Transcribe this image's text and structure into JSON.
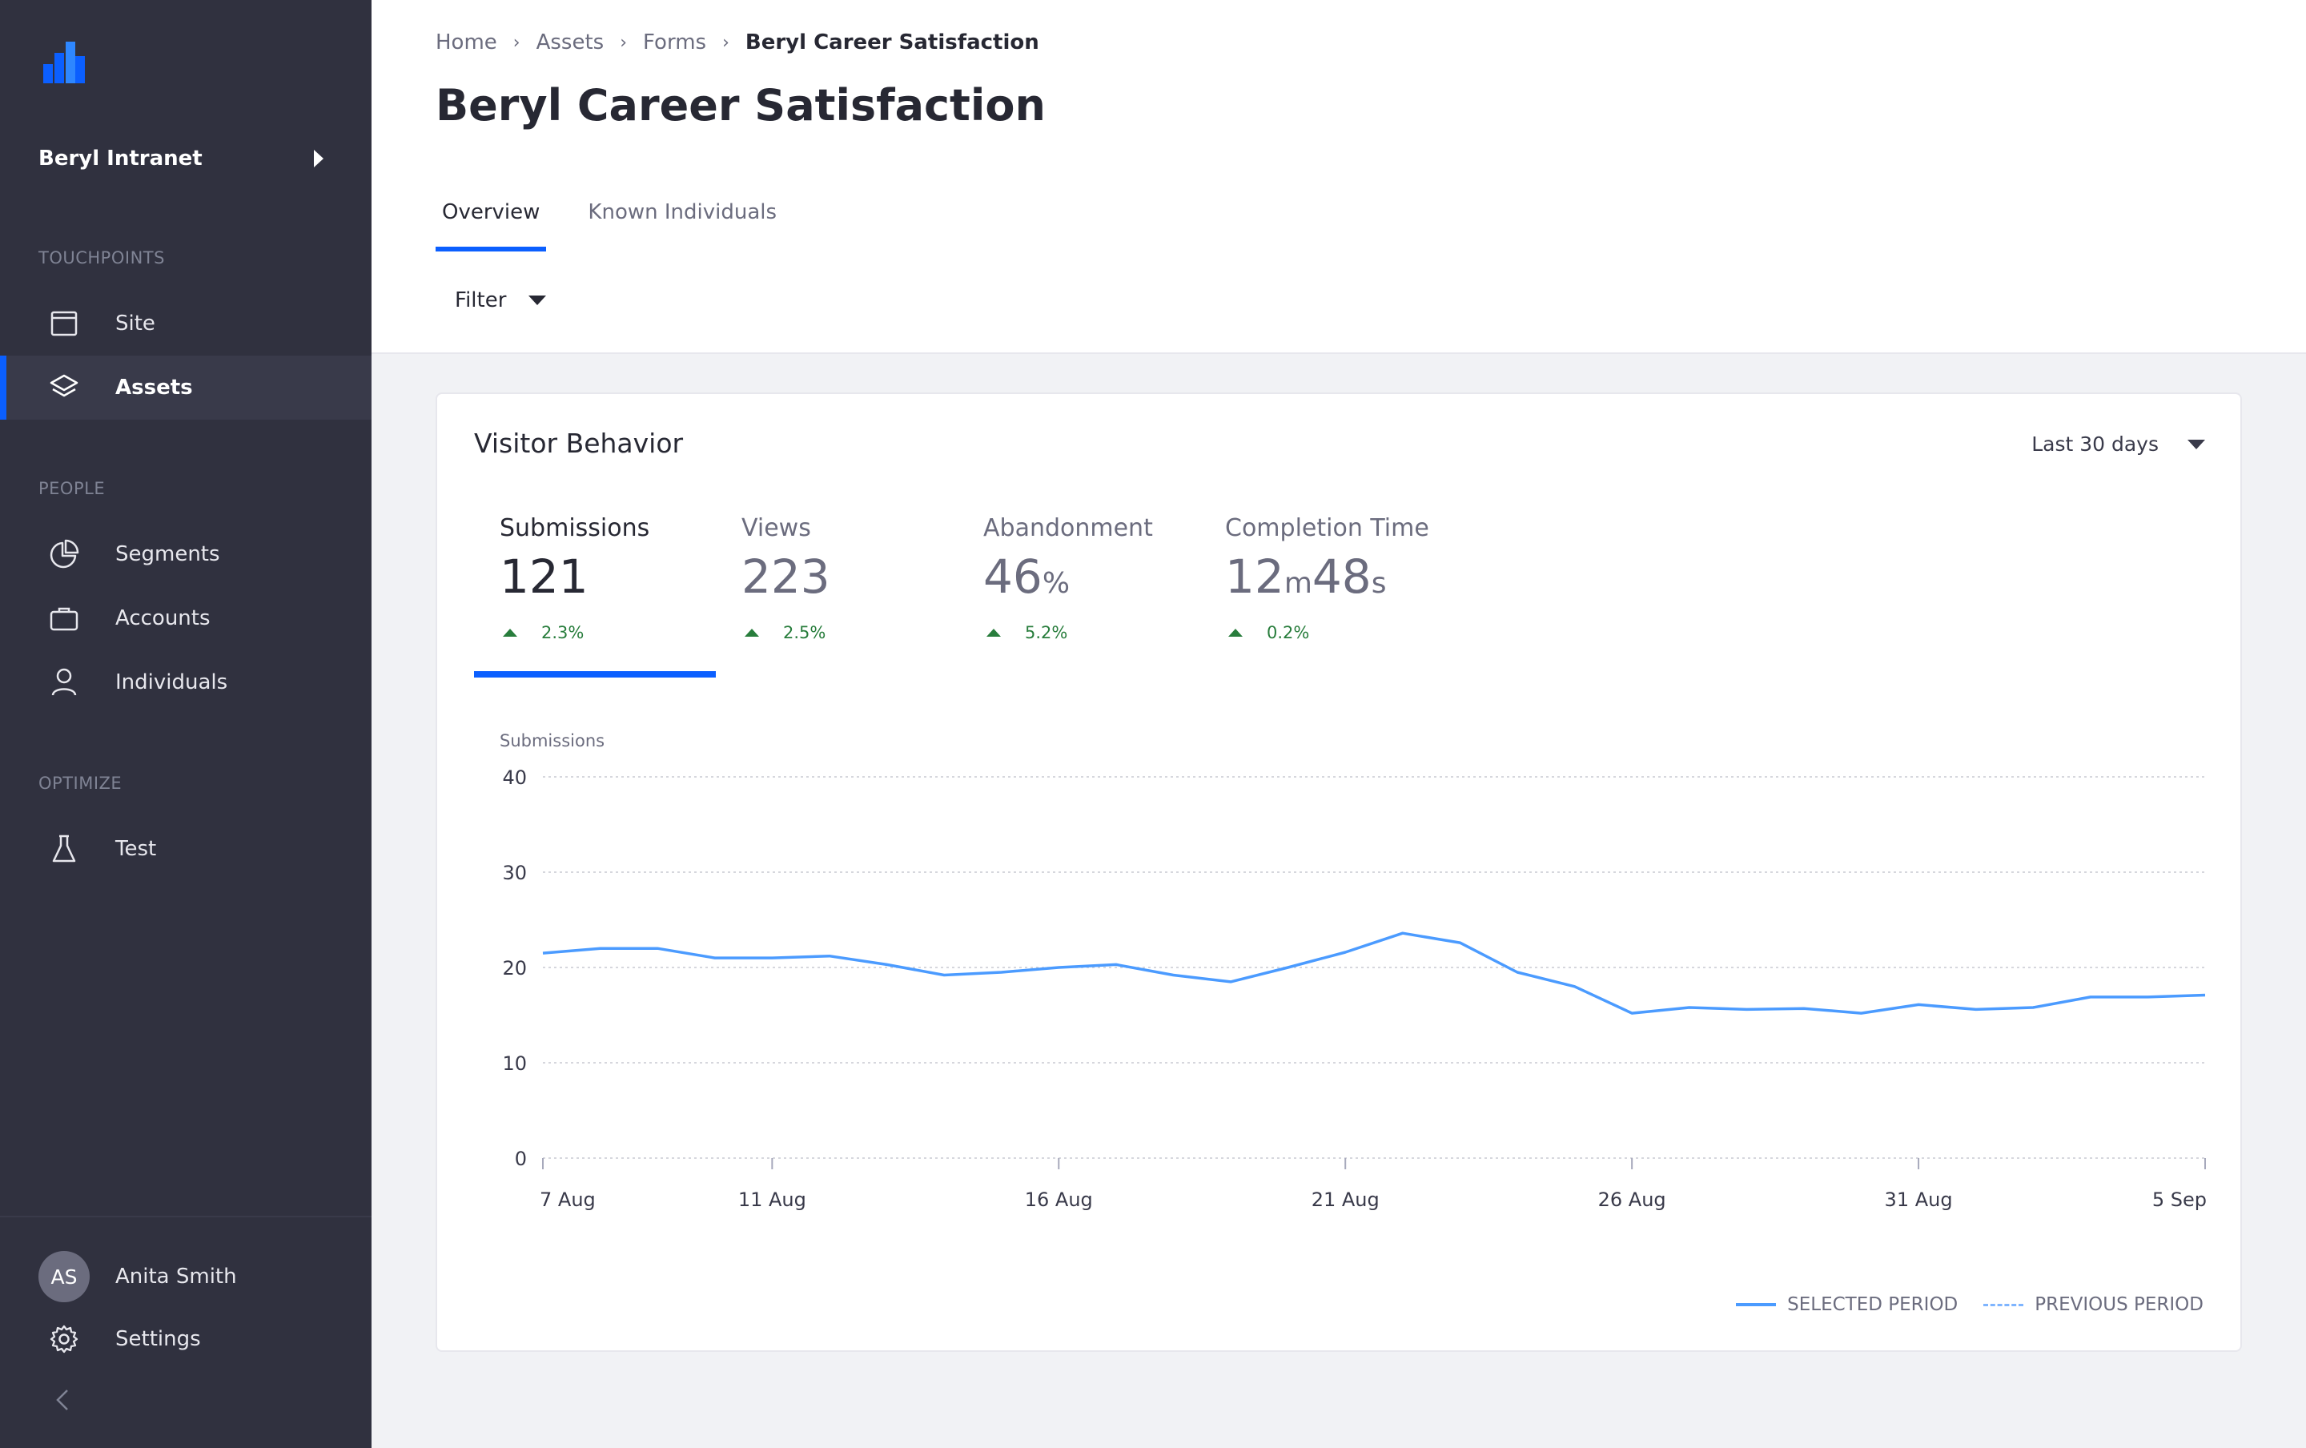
{
  "sidebar": {
    "property_name": "Beryl Intranet",
    "sections": {
      "touchpoints": "TOUCHPOINTS",
      "people": "PEOPLE",
      "optimize": "OPTIMIZE"
    },
    "items": {
      "site": "Site",
      "assets": "Assets",
      "segments": "Segments",
      "accounts": "Accounts",
      "individuals": "Individuals",
      "test": "Test"
    },
    "active_item": "Assets",
    "user": {
      "initials": "AS",
      "name": "Anita Smith"
    },
    "settings": "Settings",
    "accent_color": "#0b5fff"
  },
  "breadcrumb": {
    "items": [
      "Home",
      "Assets",
      "Forms"
    ],
    "current": "Beryl Career Satisfaction"
  },
  "page_title": "Beryl Career Satisfaction",
  "tabs": {
    "overview": "Overview",
    "known_individuals": "Known Individuals",
    "active": "Overview"
  },
  "filter": {
    "label": "Filter"
  },
  "card": {
    "title": "Visitor Behavior",
    "range": "Last 30 days",
    "metrics": {
      "submissions": {
        "label": "Submissions",
        "value": "121",
        "trend": "2.3%"
      },
      "views": {
        "label": "Views",
        "value": "223",
        "trend": "2.5%"
      },
      "abandonment": {
        "label": "Abandonment",
        "value": "46",
        "unit": "%",
        "trend": "5.2%"
      },
      "completion": {
        "label": "Completion Time",
        "minutes": "12",
        "m_unit": "m",
        "seconds": "48",
        "s_unit": "s",
        "trend": "0.2%"
      }
    },
    "active_metric": "Submissions",
    "legend": {
      "selected": "SELECTED PERIOD",
      "previous": "PREVIOUS PERIOD"
    }
  },
  "chart_data": {
    "type": "line",
    "ylabel": "Submissions",
    "ylim": [
      0,
      40
    ],
    "yticks": [
      "40",
      "30",
      "20",
      "10",
      "0"
    ],
    "xticks": [
      "7 Aug",
      "11 Aug",
      "16 Aug",
      "21 Aug",
      "26 Aug",
      "31 Aug",
      "5 Sep"
    ],
    "x": [
      "7 Aug",
      "8 Aug",
      "9 Aug",
      "10 Aug",
      "11 Aug",
      "12 Aug",
      "13 Aug",
      "14 Aug",
      "15 Aug",
      "16 Aug",
      "17 Aug",
      "18 Aug",
      "19 Aug",
      "20 Aug",
      "21 Aug",
      "22 Aug",
      "23 Aug",
      "24 Aug",
      "25 Aug",
      "26 Aug",
      "27 Aug",
      "28 Aug",
      "29 Aug",
      "30 Aug",
      "31 Aug",
      "1 Sep",
      "2 Sep",
      "3 Sep",
      "4 Sep",
      "5 Sep"
    ],
    "series": [
      {
        "name": "SELECTED PERIOD",
        "color": "#4b9bff",
        "values": [
          21.5,
          22.0,
          22.0,
          21.0,
          21.0,
          21.2,
          20.3,
          19.2,
          19.5,
          20.0,
          20.3,
          19.2,
          18.5,
          20.0,
          21.6,
          23.6,
          22.6,
          19.5,
          18.0,
          15.2,
          15.8,
          15.6,
          15.7,
          15.2,
          16.1,
          15.6,
          15.8,
          16.9,
          16.9,
          17.1
        ]
      }
    ],
    "grid": true,
    "legend_position": "bottom-right"
  }
}
